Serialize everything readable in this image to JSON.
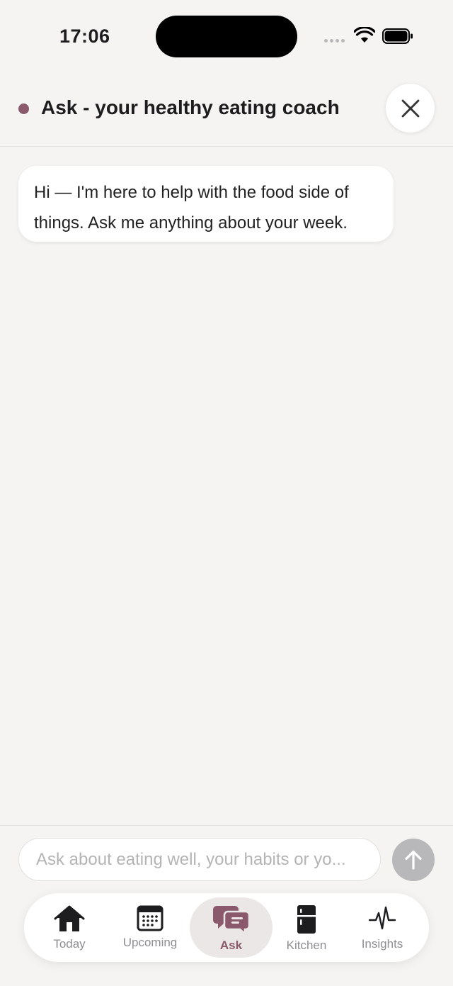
{
  "status_bar": {
    "time": "17:06"
  },
  "header": {
    "title": "Ask - your healthy eating coach"
  },
  "chat": {
    "messages": [
      {
        "text": "Hi — I'm here to help with the food side of things. Ask me anything about your week."
      }
    ]
  },
  "composer": {
    "placeholder": "Ask about eating well, your habits or yo..."
  },
  "tabs": [
    {
      "label": "Today",
      "icon": "home-icon"
    },
    {
      "label": "Upcoming",
      "icon": "calendar-icon"
    },
    {
      "label": "Ask",
      "icon": "chat-bubbles-icon",
      "active": true
    },
    {
      "label": "Kitchen",
      "icon": "fridge-icon"
    },
    {
      "label": "Insights",
      "icon": "pulse-icon"
    }
  ],
  "colors": {
    "accent": "#8a5a6c",
    "background": "#f5f4f2",
    "send_button": "#b8b8bb"
  }
}
